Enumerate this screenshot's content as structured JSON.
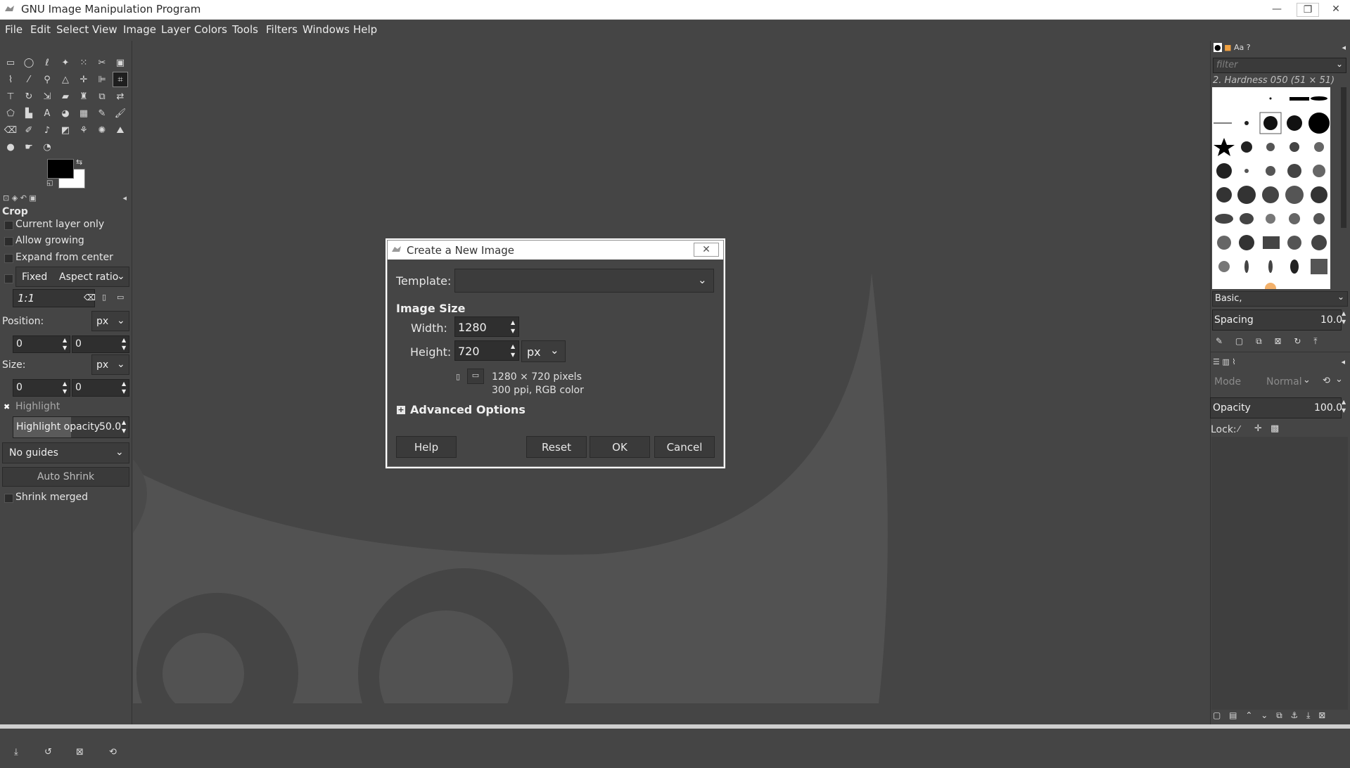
{
  "window": {
    "title": "GNU Image Manipulation Program",
    "controls": [
      "minimize-icon",
      "restore-icon",
      "close-icon"
    ]
  },
  "menubar": [
    "File",
    "Edit",
    "Select",
    "View",
    "Image",
    "Layer",
    "Colors",
    "Tools",
    "Filters",
    "Windows",
    "Help"
  ],
  "tool_options": {
    "title": "Crop",
    "current_layer_only": "Current layer only",
    "allow_growing": "Allow growing",
    "expand_from_center": "Expand from center",
    "fixed_label": "Fixed",
    "fixed_mode": "Aspect ratio",
    "ratio_value": "1:1",
    "position_label": "Position:",
    "position_unit": "px",
    "position_x": "0",
    "position_y": "0",
    "size_label": "Size:",
    "size_unit": "px",
    "size_w": "0",
    "size_h": "0",
    "highlight_label": "Highlight",
    "highlight_opacity_label": "Highlight opacity",
    "highlight_opacity_value": "50.0",
    "highlight_opacity_fraction": 0.5,
    "guides": "No guides",
    "auto_shrink": "Auto Shrink",
    "shrink_merged": "Shrink merged"
  },
  "dialog": {
    "title": "Create a New Image",
    "template_label": "Template:",
    "template_value": "",
    "image_size_heading": "Image Size",
    "width_label": "Width:",
    "width_value": "1280",
    "height_label": "Height:",
    "height_value": "720",
    "unit": "px",
    "info_pixels": "1280 × 720 pixels",
    "info_resolution": "300 ppi, RGB color",
    "advanced_options": "Advanced Options",
    "help_button": "Help",
    "reset_button": "Reset",
    "ok_button": "OK",
    "cancel_button": "Cancel"
  },
  "brushes": {
    "filter_placeholder": "filter",
    "selected_brush": "2. Hardness 050 (51 × 51)",
    "preset": "Basic,",
    "spacing_label": "Spacing",
    "spacing_value": "10.0"
  },
  "layers": {
    "mode_label": "Mode",
    "mode_value": "Normal",
    "opacity_label": "Opacity",
    "opacity_value": "100.0",
    "lock_label": "Lock:"
  },
  "colors": {
    "foreground": "#000000",
    "background": "#ffffff"
  }
}
